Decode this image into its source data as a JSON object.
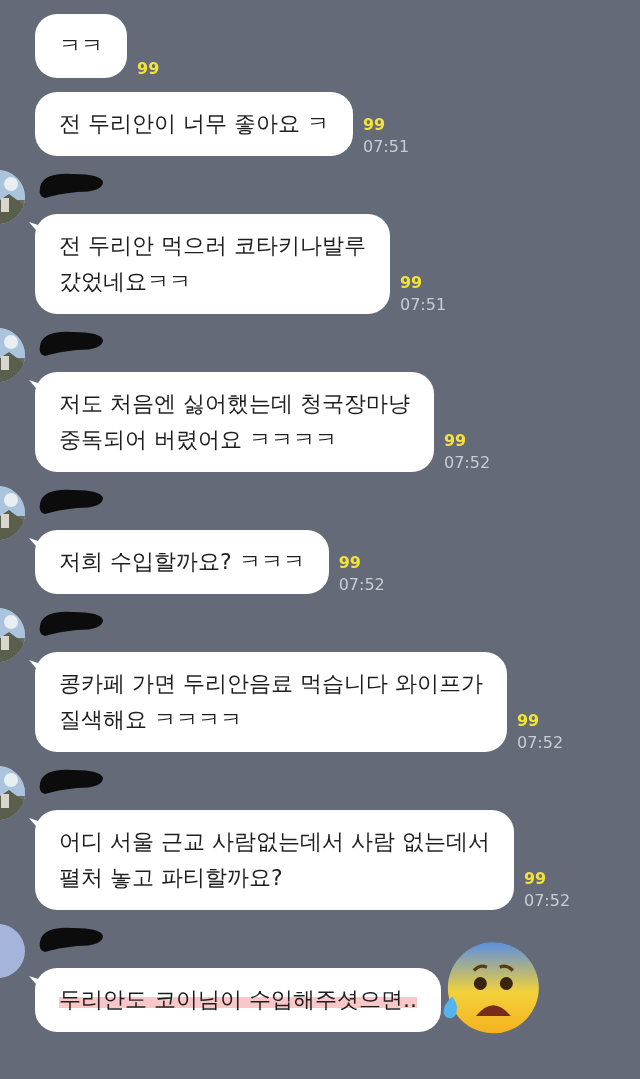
{
  "messages": [
    {
      "header": false,
      "text": "ㅋㅋ",
      "unread": "99"
    },
    {
      "header": false,
      "text": "전 두리안이 너무 좋아요 ㅋ",
      "unread": "99",
      "time": "07:51"
    },
    {
      "header": true,
      "text": "전 두리안 먹으러 코타키나발루\n갔었네요ㅋㅋ",
      "unread": "99",
      "time": "07:51"
    },
    {
      "header": true,
      "text": "저도 처음엔 싫어했는데 청국장마냥\n중독되어 버렸어요 ㅋㅋㅋㅋ",
      "unread": "99",
      "time": "07:52"
    },
    {
      "header": true,
      "text": "저희 수입할까요? ㅋㅋㅋ",
      "unread": "99",
      "time": "07:52"
    },
    {
      "header": true,
      "text": "콩카페 가면 두리안음료 먹습니다 와이프가\n질색해요 ㅋㅋㅋㅋ",
      "unread": "99",
      "time": "07:52"
    },
    {
      "header": true,
      "text": "어디 서울 근교 사람없는데서 사람 없는데서\n펼처 놓고 파티할까요?",
      "unread": "99",
      "time": "07:52"
    },
    {
      "header": true,
      "avatar": {
        "kind": "default"
      },
      "text": "두리안도 코이님이 수입해주셧으면..",
      "highlighted": true,
      "emoji": {
        "kind": "anxious"
      }
    }
  ]
}
